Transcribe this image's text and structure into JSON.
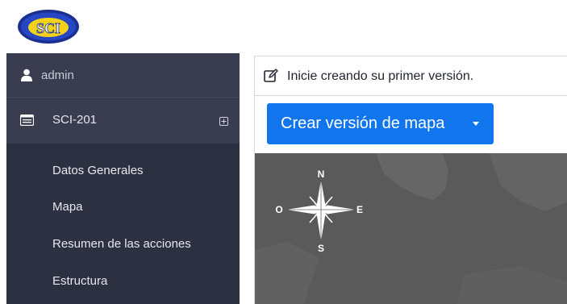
{
  "header": {
    "logo_text": "SCI"
  },
  "sidebar": {
    "user": {
      "name": "admin",
      "icon": "user-icon"
    },
    "section": {
      "label": "SCI-201",
      "icon": "list-icon",
      "expand_icon": "plus-square-icon"
    },
    "items": [
      {
        "label": "Datos Generales"
      },
      {
        "label": "Mapa"
      },
      {
        "label": "Resumen de las acciones"
      },
      {
        "label": "Estructura"
      }
    ]
  },
  "main": {
    "notice": {
      "text": "Inicie creando su primer versión.",
      "icon": "edit-icon"
    },
    "create_button": {
      "label": "Crear versión de mapa"
    },
    "compass": {
      "n": "N",
      "s": "S",
      "e": "E",
      "o": "O"
    }
  },
  "colors": {
    "sidebar_bg": "#2c3040",
    "sidebar_active_bg": "#393d4f",
    "button_blue": "#1175ee",
    "map_gray": "#5c5c5c"
  }
}
